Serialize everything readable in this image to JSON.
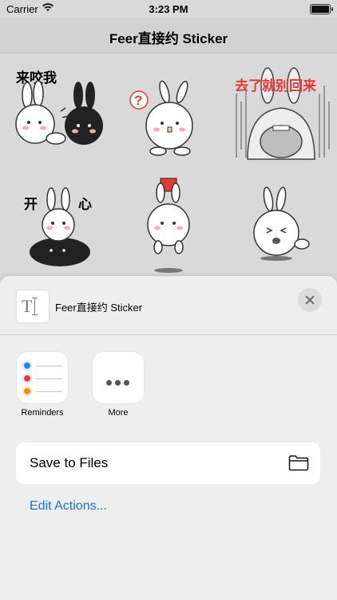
{
  "status_bar": {
    "carrier": "Carrier",
    "time": "3:23 PM"
  },
  "nav": {
    "title": "Feer直接约 Sticker"
  },
  "stickers": [
    {
      "caption": "来咬我"
    },
    {
      "caption": "?"
    },
    {
      "caption": "去了就别回来"
    },
    {
      "caption_left": "开",
      "caption_right": "心"
    },
    {
      "caption": ""
    },
    {
      "caption": ""
    }
  ],
  "share_sheet": {
    "document_title": "Feer直接约 Sticker",
    "apps": [
      {
        "label": "Reminders",
        "icon": "reminders-icon"
      },
      {
        "label": "More",
        "icon": "more-icon"
      }
    ],
    "actions": [
      {
        "label": "Save to Files",
        "icon": "folder-icon"
      }
    ],
    "edit_actions_label": "Edit Actions..."
  },
  "colors": {
    "accent": "#1a73d6",
    "reminder_dots": [
      "#1e88e5",
      "#e53935",
      "#fb8c00"
    ]
  }
}
